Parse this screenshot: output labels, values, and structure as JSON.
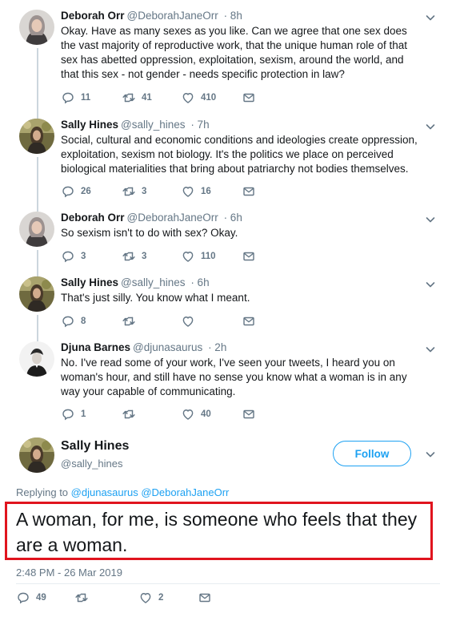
{
  "tweets": [
    {
      "name": "Deborah Orr",
      "handle": "@DeborahJaneOrr",
      "time": "· 8h",
      "text": "Okay. Have as many sexes as you like. Can we agree that one sex does the vast majority of reproductive work, that the unique human role of that sex has abetted oppression, exploitation, sexism, around the world, and that this sex - not gender - needs specific protection in law?",
      "replies": "11",
      "retweets": "41",
      "likes": "410"
    },
    {
      "name": "Sally Hines",
      "handle": "@sally_hines",
      "time": "· 7h",
      "text": "Social, cultural and economic conditions and ideologies create oppression, exploitation, sexism not biology. It's the politics we place on perceived biological materialities that bring about patriarchy not bodies themselves.",
      "replies": "26",
      "retweets": "3",
      "likes": "16"
    },
    {
      "name": "Deborah Orr",
      "handle": "@DeborahJaneOrr",
      "time": "· 6h",
      "text": "So sexism isn't to do with sex? Okay.",
      "replies": "3",
      "retweets": "3",
      "likes": "110"
    },
    {
      "name": "Sally Hines",
      "handle": "@sally_hines",
      "time": "· 6h",
      "text": "That's just silly. You know what I meant.",
      "replies": "8",
      "retweets": "",
      "likes": ""
    },
    {
      "name": "Djuna Barnes",
      "handle": "@djunasaurus",
      "time": "· 2h",
      "text": "No. I've read some of your work, I've seen your tweets, I heard you on woman's hour, and still have no sense you know what a woman is in any way your capable of communicating.",
      "replies": "1",
      "retweets": "",
      "likes": "40"
    }
  ],
  "focus": {
    "name": "Sally Hines",
    "handle": "@sally_hines",
    "follow_label": "Follow",
    "replying_prefix": "Replying to",
    "replying_to_1": "@djunasaurus",
    "replying_to_2": "@DeborahJaneOrr",
    "text": "A woman, for me, is someone who feels that they are a woman.",
    "timestamp": "2:48 PM - 26 Mar 2019",
    "replies": "49",
    "retweets": "",
    "likes": "2"
  },
  "colors": {
    "accent": "#1da1f2",
    "muted": "#657786",
    "highlight_border": "#e0141e"
  },
  "icons": {
    "reply": "reply-icon",
    "retweet": "retweet-icon",
    "like": "heart-icon",
    "dm": "envelope-icon",
    "menu": "chevron-down-icon"
  }
}
